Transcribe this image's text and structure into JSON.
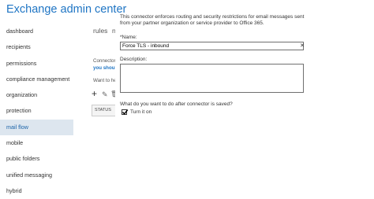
{
  "app": {
    "title": "Exchange admin center"
  },
  "sidebar": {
    "items": [
      {
        "label": "dashboard",
        "active": false
      },
      {
        "label": "recipients",
        "active": false
      },
      {
        "label": "permissions",
        "active": false
      },
      {
        "label": "compliance management",
        "active": false
      },
      {
        "label": "organization",
        "active": false
      },
      {
        "label": "protection",
        "active": false
      },
      {
        "label": "mail flow",
        "active": true
      },
      {
        "label": "mobile",
        "active": false
      },
      {
        "label": "public folders",
        "active": false
      },
      {
        "label": "unified messaging",
        "active": false
      },
      {
        "label": "hybrid",
        "active": false
      }
    ]
  },
  "background": {
    "tabs": [
      "rules",
      "n"
    ],
    "connectors_text": "Connector",
    "link_text": "you should",
    "want_text": "Want to he",
    "status_header": "STATUS",
    "add_icon_glyph": "+",
    "edit_icon_glyph": "✎",
    "delete_icon_glyph": "🗑"
  },
  "dialog": {
    "description": "This connector enforces routing and security restrictions for email messages sent from your partner organization or service provider to Office 365.",
    "name_label": "*Name:",
    "name_value": "Force TLS - inbound",
    "clear_glyph": "✕",
    "description_label": "Description:",
    "description_value": "",
    "question": "What do you want to do after connector is saved?",
    "checkbox_label": "Turn it on",
    "checkbox_checked": true
  }
}
